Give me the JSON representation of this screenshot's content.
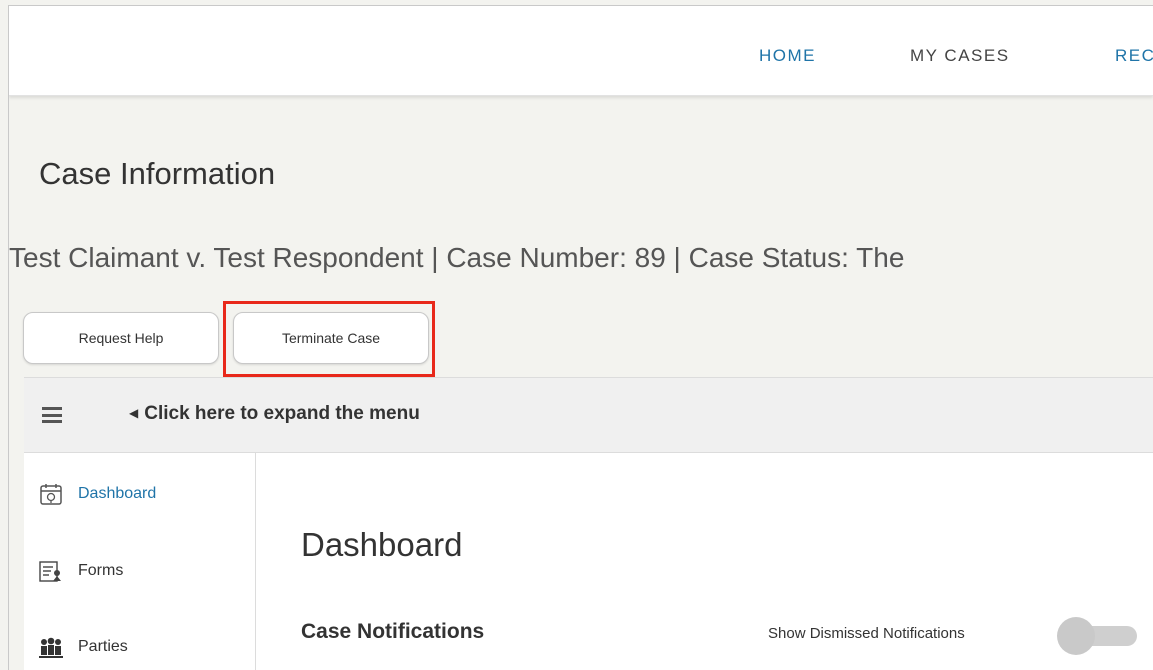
{
  "nav": {
    "home": "HOME",
    "my_cases": "MY CASES",
    "partial": "REC"
  },
  "page_title": "Case Information",
  "case_summary": "Test Claimant v. Test Respondent | Case Number: 89 | Case Status:  The",
  "buttons": {
    "request_help": "Request Help",
    "terminate_case": "Terminate Case"
  },
  "menu_bar": {
    "expand_text": "Click here to expand the menu"
  },
  "sidebar": {
    "items": [
      {
        "label": "Dashboard",
        "icon": "calendar-icon",
        "active": true
      },
      {
        "label": "Forms",
        "icon": "forms-icon",
        "active": false
      },
      {
        "label": "Parties",
        "icon": "parties-icon",
        "active": false
      }
    ]
  },
  "main": {
    "title": "Dashboard",
    "notifications_title": "Case Notifications",
    "show_dismissed_label": "Show Dismissed Notifications"
  },
  "colors": {
    "link_blue": "#1f74a8",
    "highlight_red": "#e8281a"
  }
}
